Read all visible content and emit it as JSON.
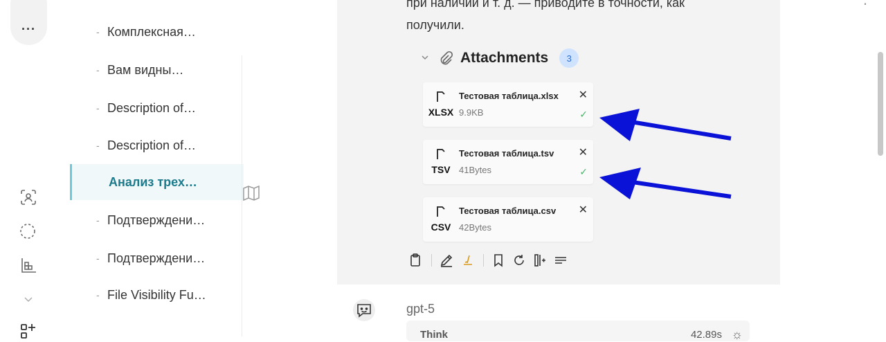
{
  "rail": {
    "more_label": "···"
  },
  "sidebar": {
    "items": [
      {
        "label": "Комплексная…",
        "active": false
      },
      {
        "label": "Вам видны…",
        "active": false
      },
      {
        "label": "Description of…",
        "active": false
      },
      {
        "label": "Description of…",
        "active": false
      },
      {
        "label": "Анализ трех…",
        "active": true
      },
      {
        "label": "Подтверждени…",
        "active": false
      },
      {
        "label": "Подтверждени…",
        "active": false
      },
      {
        "label": "File Visibility Fu…",
        "active": false
      }
    ],
    "dash": "-"
  },
  "message": {
    "text_line1": "при наличии и т. д. — приводите в точности, как",
    "text_line2": "получили."
  },
  "attachments": {
    "title": "Attachments",
    "count": "3",
    "files": [
      {
        "ext": "XLSX",
        "name": "Тестовая таблица.xlsx",
        "size": "9.9KB",
        "uploaded": true
      },
      {
        "ext": "TSV",
        "name": "Тестовая таблица.tsv",
        "size": "41Bytes",
        "uploaded": true
      },
      {
        "ext": "CSV",
        "name": "Тестовая таблица.csv",
        "size": "42Bytes",
        "uploaded": false
      }
    ]
  },
  "next_message": {
    "model": "gpt-5",
    "think_label": "Think",
    "think_time": "42.89s"
  },
  "colors": {
    "accent": "#1b7b8c",
    "active_border": "#6dc9d9",
    "arrow": "#0a12d8",
    "check": "#4bb26a",
    "badge_bg": "#cfe3ff"
  }
}
